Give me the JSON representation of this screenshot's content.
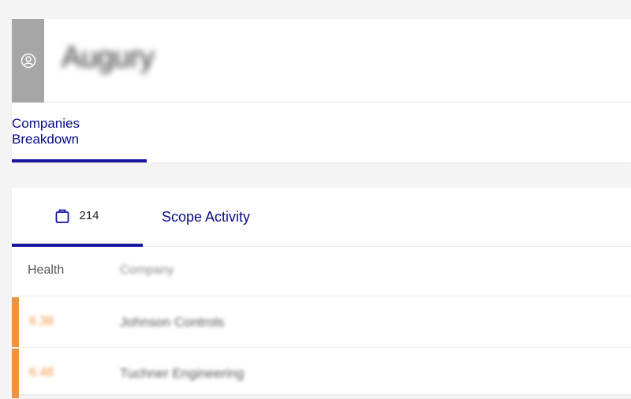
{
  "header": {
    "company_name": "Augury",
    "avatar_icon": "user-circle-icon",
    "tabs": [
      {
        "label": "Companies Breakdown",
        "active": true
      }
    ]
  },
  "subtabs": {
    "count_icon": "briefcase-icon",
    "count": "214",
    "scope_label": "Scope Activity"
  },
  "table": {
    "columns": {
      "health": "Health",
      "company": "Company"
    },
    "rows": [
      {
        "health": "6.38",
        "company": "Johnson Controls"
      },
      {
        "health": "6.48",
        "company": "Tuchner Engineering"
      }
    ]
  },
  "colors": {
    "accent": "#1515a0",
    "health_orange": "#f0923f",
    "avatar_bg": "#a6a6a6"
  }
}
